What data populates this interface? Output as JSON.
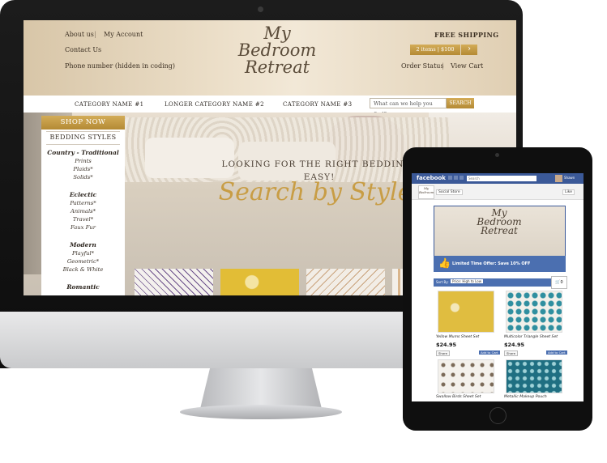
{
  "site": {
    "header": {
      "about": "About us",
      "account": "My Account",
      "contact": "Contact Us",
      "phone": "Phone number (hidden in coding)",
      "logo_lines": [
        "My",
        "Bedroom",
        "Retreat"
      ],
      "shipping": "FREE SHIPPING",
      "cart_summary": "2 items | $100",
      "order_status": "Order Status",
      "view_cart": "View Cart",
      "chevron": "›"
    },
    "nav": {
      "cat1": "CATEGORY NAME #1",
      "cat2": "LONGER CATEGORY NAME #2",
      "cat3": "CATEGORY NAME #3",
      "search_placeholder": "What can we help you find?",
      "search_button": "SEARCH"
    },
    "sidebar": {
      "shop_now": "SHOP NOW",
      "heading": "BEDDING STYLES",
      "groups": [
        {
          "title": "Country - Traditional",
          "items": [
            "Prints",
            "Plaids*",
            "Solids*"
          ]
        },
        {
          "title": "Eclectic",
          "items": [
            "Patterns*",
            "Animals*",
            "Travel*",
            "Faux Fur"
          ]
        },
        {
          "title": "Modern",
          "items": [
            "Playful*",
            "Geometric*",
            "Black & White"
          ]
        },
        {
          "title": "Romantic",
          "items": []
        }
      ]
    },
    "hero": {
      "tagline_1": "LOOKING FOR THE RIGHT BEDDING?",
      "tagline_2": "EASY!",
      "script": "Search by Style"
    }
  },
  "facebook": {
    "logo": "facebook",
    "search_placeholder": "Search",
    "user": "Shawn",
    "store_tab": "Social Store",
    "like": "Like",
    "banner_logo_lines": [
      "My",
      "Bedroom",
      "Retreat"
    ],
    "promo": "Limited Time Offer: Save 10% OFF",
    "sort_label": "Sort By:",
    "sort_value": "Price: High to Low",
    "cart_count": "0",
    "products": [
      {
        "title": "Yellow Mums Sheet Set",
        "price": "$24.95",
        "share": "Share",
        "add": "Add to Cart"
      },
      {
        "title": "Multicolor Triangle Sheet Set",
        "price": "$24.95",
        "share": "Share",
        "add": "Add to Cart"
      },
      {
        "title": "Swallow Birds Sheet Set",
        "price": "",
        "share": "",
        "add": ""
      },
      {
        "title": "Metallic Makeup Pouch",
        "price": "",
        "share": "",
        "add": ""
      }
    ]
  },
  "colors": {
    "gold": "#c39a48",
    "facebook_blue": "#3b5998",
    "store_blue": "#4b6fb0"
  }
}
